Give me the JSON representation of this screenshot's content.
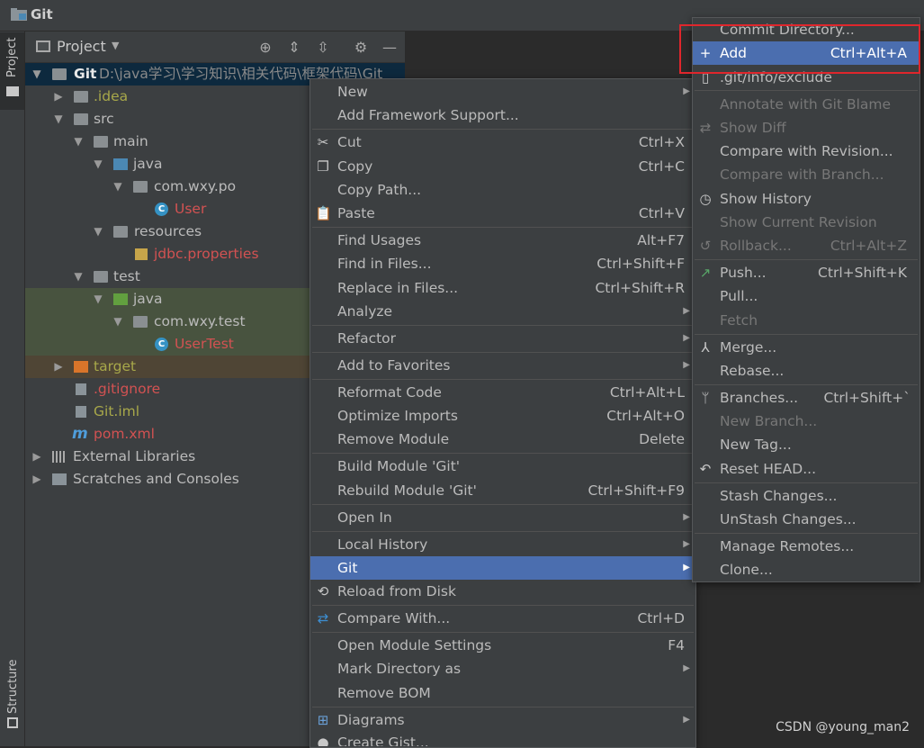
{
  "window": {
    "title": "Git"
  },
  "side_tabs": {
    "project": "Project",
    "structure": "Structure"
  },
  "project_panel": {
    "title": "Project"
  },
  "tree": [
    {
      "label": "Git",
      "path": "D:\\java学习\\学习知识\\相关代码\\框架代码\\Git",
      "kind": "module",
      "color": "#d0d0d0"
    },
    {
      "label": ".idea",
      "kind": "folder",
      "color": "#a8a84a"
    },
    {
      "label": "src",
      "kind": "folder",
      "color": "#bbbbbb"
    },
    {
      "label": "main",
      "kind": "folder",
      "color": "#bbbbbb"
    },
    {
      "label": "java",
      "kind": "folder-blue",
      "color": "#bbbbbb"
    },
    {
      "label": "com.wxy.po",
      "kind": "package",
      "color": "#bbbbbb"
    },
    {
      "label": "User",
      "kind": "class",
      "color": "#d25252"
    },
    {
      "label": "resources",
      "kind": "folder-res",
      "color": "#bbbbbb"
    },
    {
      "label": "jdbc.properties",
      "kind": "props",
      "color": "#d25252"
    },
    {
      "label": "test",
      "kind": "folder",
      "color": "#bbbbbb"
    },
    {
      "label": "java",
      "kind": "folder-green",
      "color": "#bbbbbb"
    },
    {
      "label": "com.wxy.test",
      "kind": "package",
      "color": "#bbbbbb"
    },
    {
      "label": "UserTest",
      "kind": "class",
      "color": "#d25252"
    },
    {
      "label": "target",
      "kind": "folder-orange",
      "color": "#a8a84a"
    },
    {
      "label": ".gitignore",
      "kind": "file",
      "color": "#d25252"
    },
    {
      "label": "Git.iml",
      "kind": "file",
      "color": "#a8a84a"
    },
    {
      "label": "pom.xml",
      "kind": "maven",
      "color": "#d25252"
    },
    {
      "label": "External Libraries",
      "kind": "libs",
      "color": "#bbbbbb"
    },
    {
      "label": "Scratches and Consoles",
      "kind": "scratch",
      "color": "#bbbbbb"
    }
  ],
  "context_menu": {
    "items": [
      {
        "label": "New",
        "shortcut": "",
        "submenu": true
      },
      {
        "label": "Add Framework Support...",
        "shortcut": ""
      },
      {
        "label": "Cut",
        "shortcut": "Ctrl+X",
        "icon": "scissors-icon"
      },
      {
        "label": "Copy",
        "shortcut": "Ctrl+C",
        "icon": "copy-icon"
      },
      {
        "label": "Copy Path...",
        "shortcut": ""
      },
      {
        "label": "Paste",
        "shortcut": "Ctrl+V",
        "icon": "clipboard-icon"
      },
      {
        "label": "Find Usages",
        "shortcut": "Alt+F7"
      },
      {
        "label": "Find in Files...",
        "shortcut": "Ctrl+Shift+F"
      },
      {
        "label": "Replace in Files...",
        "shortcut": "Ctrl+Shift+R"
      },
      {
        "label": "Analyze",
        "shortcut": "",
        "submenu": true
      },
      {
        "label": "Refactor",
        "shortcut": "",
        "submenu": true
      },
      {
        "label": "Add to Favorites",
        "shortcut": "",
        "submenu": true
      },
      {
        "label": "Reformat Code",
        "shortcut": "Ctrl+Alt+L"
      },
      {
        "label": "Optimize Imports",
        "shortcut": "Ctrl+Alt+O"
      },
      {
        "label": "Remove Module",
        "shortcut": "Delete"
      },
      {
        "label": "Build Module 'Git'",
        "shortcut": ""
      },
      {
        "label": "Rebuild Module 'Git'",
        "shortcut": "Ctrl+Shift+F9"
      },
      {
        "label": "Open In",
        "shortcut": "",
        "submenu": true
      },
      {
        "label": "Local History",
        "shortcut": "",
        "submenu": true
      },
      {
        "label": "Git",
        "shortcut": "",
        "submenu": true,
        "selected": true
      },
      {
        "label": "Reload from Disk",
        "shortcut": "",
        "icon": "reload-icon"
      },
      {
        "label": "Compare With...",
        "shortcut": "Ctrl+D",
        "icon": "compare-icon"
      },
      {
        "label": "Open Module Settings",
        "shortcut": "F4"
      },
      {
        "label": "Mark Directory as",
        "shortcut": "",
        "submenu": true
      },
      {
        "label": "Remove BOM",
        "shortcut": ""
      },
      {
        "label": "Diagrams",
        "shortcut": "",
        "submenu": true,
        "icon": "diagram-icon"
      },
      {
        "label": "Create Gist...",
        "shortcut": "",
        "icon": "github-icon"
      }
    ]
  },
  "git_menu": {
    "items": [
      {
        "label": "Commit Directory...",
        "shortcut": ""
      },
      {
        "label": "Add",
        "shortcut": "Ctrl+Alt+A",
        "selected": true,
        "icon": "plus-icon"
      },
      {
        "label": ".git/info/exclude",
        "shortcut": "",
        "icon": "file-icon"
      },
      {
        "label": "Annotate with Git Blame",
        "shortcut": "",
        "disabled": true
      },
      {
        "label": "Show Diff",
        "shortcut": "",
        "disabled": true,
        "icon": "diff-icon"
      },
      {
        "label": "Compare with Revision...",
        "shortcut": ""
      },
      {
        "label": "Compare with Branch...",
        "shortcut": "",
        "disabled": true
      },
      {
        "label": "Show History",
        "shortcut": "",
        "icon": "clock-icon"
      },
      {
        "label": "Show Current Revision",
        "shortcut": "",
        "disabled": true
      },
      {
        "label": "Rollback...",
        "shortcut": "Ctrl+Alt+Z",
        "disabled": true,
        "icon": "rollback-icon"
      },
      {
        "label": "Push...",
        "shortcut": "Ctrl+Shift+K",
        "icon": "push-icon"
      },
      {
        "label": "Pull...",
        "shortcut": ""
      },
      {
        "label": "Fetch",
        "shortcut": "",
        "disabled": true
      },
      {
        "label": "Merge...",
        "shortcut": "",
        "icon": "merge-icon"
      },
      {
        "label": "Rebase...",
        "shortcut": ""
      },
      {
        "label": "Branches...",
        "shortcut": "Ctrl+Shift+`",
        "icon": "branch-icon"
      },
      {
        "label": "New Branch...",
        "shortcut": "",
        "disabled": true
      },
      {
        "label": "New Tag...",
        "shortcut": ""
      },
      {
        "label": "Reset HEAD...",
        "shortcut": "",
        "icon": "reset-icon"
      },
      {
        "label": "Stash Changes...",
        "shortcut": ""
      },
      {
        "label": "UnStash Changes...",
        "shortcut": ""
      },
      {
        "label": "Manage Remotes...",
        "shortcut": ""
      },
      {
        "label": "Clone...",
        "shortcut": ""
      }
    ]
  },
  "watermark": "CSDN @young_man2",
  "colors": {
    "selection": "#4b6eaf",
    "highlight_box": "#e0262c",
    "panel": "#3c3f41",
    "editor": "#2b2b2b"
  }
}
